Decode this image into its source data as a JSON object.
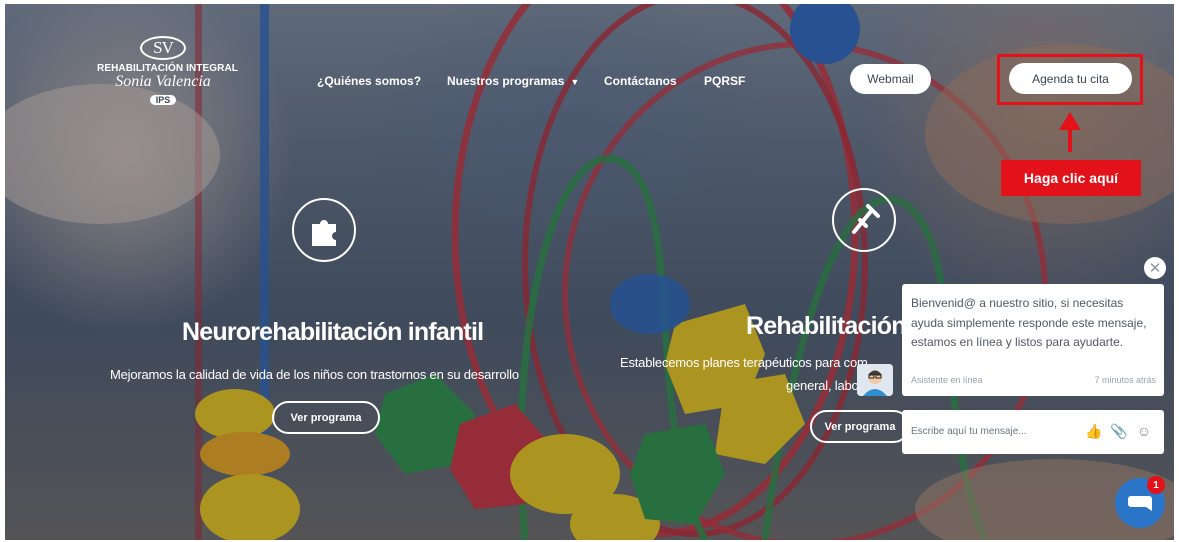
{
  "logo": {
    "monogram": "SV",
    "line1": "REHABILITACIÓN INTEGRAL",
    "line2": "Sonia Valencia",
    "badge": "IPS",
    "icon": "logo-emblem"
  },
  "nav": {
    "items": [
      {
        "label": "¿Quiénes somos?"
      },
      {
        "label": "Nuestros programas",
        "icon": "chevron-down-icon"
      },
      {
        "label": "Contáctanos"
      },
      {
        "label": "PQRSF"
      }
    ],
    "webmail_label": "Webmail",
    "agenda_label": "Agenda tu cita"
  },
  "annotation": {
    "label": "Haga clic aquí",
    "color": "#e3121a",
    "icon": "arrow-up-icon"
  },
  "programs": [
    {
      "icon": "puzzle-icon",
      "title": "Neurorehabilitación infantil",
      "subtitle": "Mejoramos la calidad de vida de los niños con trastornos en su desarrollo",
      "button": "Ver programa"
    },
    {
      "icon": "crutch-icon",
      "title": "Rehabilitación",
      "subtitle_line1": "Establecemos planes terapéuticos para com",
      "subtitle_line2": "general, labo",
      "button": "Ver programa"
    }
  ],
  "chat": {
    "message": "Bienvenid@ a nuestro sitio, si necesitas ayuda simplemente responde este mensaje, estamos en línea y listos para ayudarte.",
    "agent": "Asistente en línea",
    "time": "7 minutos atrás",
    "input_placeholder": "Escribe aquí tu mensaje...",
    "tools": [
      "thumbs-up-icon",
      "paperclip-icon",
      "smiley-icon"
    ],
    "launcher_badge": "1",
    "launcher_color": "#2b75c9"
  }
}
